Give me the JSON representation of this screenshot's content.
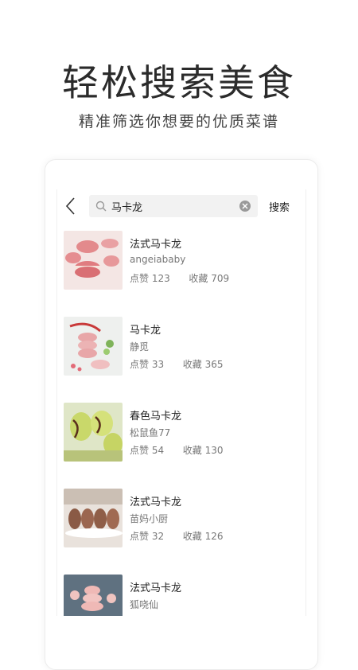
{
  "header": {
    "title": "轻松搜索美食",
    "subtitle": "精准筛选你想要的优质菜谱"
  },
  "search": {
    "query": "马卡龙",
    "button_label": "搜索"
  },
  "results": [
    {
      "title": "法式马卡龙",
      "author": "angeiababy",
      "likes_label": "点赞",
      "likes": "123",
      "favs_label": "收藏",
      "favs": "709",
      "thumb": "pink-macaron"
    },
    {
      "title": "马卡龙",
      "author": "静觅",
      "likes_label": "点赞",
      "likes": "33",
      "favs_label": "收藏",
      "favs": "365",
      "thumb": "macaron-stack"
    },
    {
      "title": "春色马卡龙",
      "author": "松鼠鱼77",
      "likes_label": "点赞",
      "likes": "54",
      "favs_label": "收藏",
      "favs": "130",
      "thumb": "green-macaron"
    },
    {
      "title": "法式马卡龙",
      "author": "苗妈小厨",
      "likes_label": "点赞",
      "likes": "32",
      "favs_label": "收藏",
      "favs": "126",
      "thumb": "brown-macaron"
    },
    {
      "title": "法式马卡龙",
      "author": "狐哓仙",
      "thumb": "pink-tower"
    }
  ],
  "colors": {
    "background": "#ffffff",
    "search_box": "#f2f2f2",
    "secondary_text": "#777777"
  }
}
